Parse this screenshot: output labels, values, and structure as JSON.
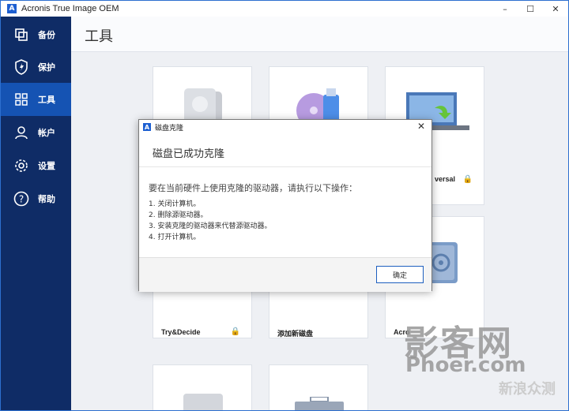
{
  "window": {
    "title": "Acronis True Image OEM",
    "controls": [
      "–",
      "☐",
      "✕"
    ]
  },
  "sidebar": {
    "items": [
      {
        "label": "备份",
        "icon": "backup-icon",
        "active": false
      },
      {
        "label": "保护",
        "icon": "shield-icon",
        "active": false
      },
      {
        "label": "工具",
        "icon": "tools-grid-icon",
        "active": true
      },
      {
        "label": "帐户",
        "icon": "account-icon",
        "active": false
      },
      {
        "label": "设置",
        "icon": "gear-icon",
        "active": false
      },
      {
        "label": "帮助",
        "icon": "help-icon",
        "active": false
      }
    ]
  },
  "content": {
    "title": "工具",
    "cards": [
      {
        "label": "",
        "locked": false,
        "icon": "disk-clone-icon"
      },
      {
        "label": "",
        "locked": false,
        "icon": "rescue-media-icon"
      },
      {
        "label": "versal",
        "locked": true,
        "icon": "universal-restore-icon"
      },
      {
        "label": "Try&Decide",
        "locked": true,
        "icon": "try-decide-icon"
      },
      {
        "label": "添加新磁盘",
        "locked": false,
        "icon": "add-disk-icon"
      },
      {
        "label": "Acro",
        "locked": false,
        "icon": "secure-zone-icon"
      },
      {
        "label": "",
        "locked": false,
        "icon": "disk-icon"
      },
      {
        "label": "",
        "locked": false,
        "icon": "toolbox-icon"
      }
    ]
  },
  "dialog": {
    "title": "磁盘克隆",
    "heading": "磁盘已成功克隆",
    "intro": "要在当前硬件上使用克隆的驱动器，请执行以下操作：",
    "steps": [
      "1. 关闭计算机。",
      "2. 删除源驱动器。",
      "3. 安装克隆的驱动器来代替源驱动器。",
      "4. 打开计算机。"
    ],
    "ok_label": "确定",
    "close_glyph": "✕"
  },
  "watermark": {
    "line1": "影客网",
    "line2": "Phoer.com",
    "corner": "新浪众测"
  },
  "lock_glyph": "🔒",
  "colors": {
    "sidebar": "#0f2c66",
    "active": "#1553b3",
    "accent": "#1d5fd1"
  }
}
